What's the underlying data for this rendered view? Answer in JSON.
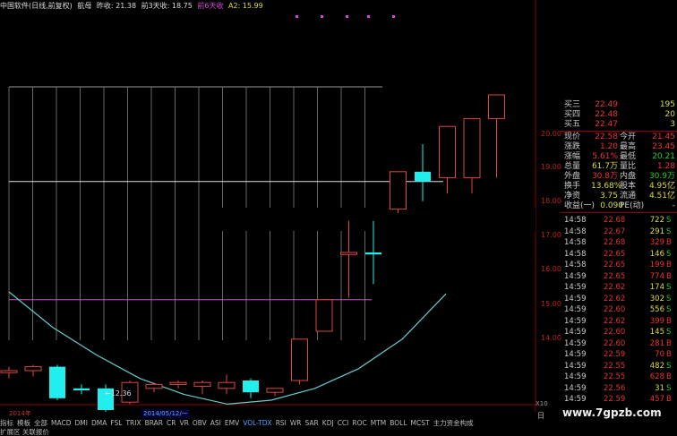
{
  "header": {
    "name": "中国软件(日线,前复权)",
    "extra": "航母",
    "prev_close": "昨收: 21.38",
    "prev3": "前3天收: 18.75",
    "prev6": "前6天收",
    "a2": "A2: 15.99"
  },
  "y_axis": [
    "20.00",
    "19.00",
    "18.00",
    "17.00",
    "16.00",
    "15.00",
    "14.00"
  ],
  "chart_data": {
    "type": "candlestick",
    "ylim": [
      13.25,
      20.75
    ],
    "candles": [
      {
        "o": 13.95,
        "h": 14.1,
        "l": 13.8,
        "c": 14.0
      },
      {
        "o": 14.0,
        "h": 14.15,
        "l": 13.85,
        "c": 14.1
      },
      {
        "o": 14.1,
        "h": 14.15,
        "l": 13.25,
        "c": 13.3
      },
      {
        "o": 13.55,
        "h": 13.65,
        "l": 13.4,
        "c": 13.5
      },
      {
        "o": 13.55,
        "h": 13.65,
        "l": 12.9,
        "c": 13.0
      },
      {
        "o": 13.2,
        "h": 13.75,
        "l": 13.15,
        "c": 13.7
      },
      {
        "o": 13.55,
        "h": 13.7,
        "l": 13.45,
        "c": 13.65
      },
      {
        "o": 13.65,
        "h": 13.75,
        "l": 13.55,
        "c": 13.7
      },
      {
        "o": 13.6,
        "h": 13.75,
        "l": 13.4,
        "c": 13.7
      },
      {
        "o": 13.55,
        "h": 13.9,
        "l": 13.4,
        "c": 13.7
      },
      {
        "o": 13.75,
        "h": 13.8,
        "l": 13.3,
        "c": 13.45
      },
      {
        "o": 13.45,
        "h": 13.55,
        "l": 13.35,
        "c": 13.55
      },
      {
        "o": 13.75,
        "h": 14.8,
        "l": 13.65,
        "c": 14.8
      },
      {
        "o": 15.0,
        "h": 15.8,
        "l": 15.0,
        "c": 15.8
      },
      {
        "o": 16.95,
        "h": 17.8,
        "l": 15.85,
        "c": 17.0
      },
      {
        "o": 17.0,
        "h": 17.8,
        "l": 16.2,
        "c": 16.95
      },
      {
        "o": 18.1,
        "h": 18.75,
        "l": 18.0,
        "c": 19.05
      },
      {
        "o": 19.05,
        "h": 19.75,
        "l": 18.3,
        "c": 18.8
      },
      {
        "o": 18.9,
        "h": 20.2,
        "l": 18.5,
        "c": 20.2
      },
      {
        "o": 18.9,
        "h": 20.4,
        "l": 18.5,
        "c": 20.4
      },
      {
        "o": 20.4,
        "h": 21.0,
        "l": 18.9,
        "c": 21.0
      }
    ],
    "curve": [
      [
        0,
        16.0
      ],
      [
        4,
        15.1
      ],
      [
        8,
        14.4
      ],
      [
        12,
        13.8
      ],
      [
        16,
        13.4
      ],
      [
        20,
        13.15
      ],
      [
        24,
        13.25
      ],
      [
        28,
        13.55
      ],
      [
        32,
        14.05
      ],
      [
        36,
        14.8
      ],
      [
        40,
        15.95
      ]
    ],
    "hlines": [
      18.8,
      15.8
    ],
    "low_note": "←12.36"
  },
  "panel": {
    "orders": [
      {
        "label": "买三",
        "price": "22.49",
        "vol": "195"
      },
      {
        "label": "买四",
        "price": "22.48",
        "vol": "20"
      },
      {
        "label": "买五",
        "price": "22.47",
        "vol": "3"
      }
    ],
    "stats": [
      {
        "l1": "现价",
        "v1": "22.58",
        "l2": "今开",
        "v2": "21.45"
      },
      {
        "l1": "涨跌",
        "v1": "1.20",
        "l2": "最高",
        "v2": "23.45"
      },
      {
        "l1": "涨幅",
        "v1": "5.61%",
        "l2": "最低",
        "v2": "20.21"
      },
      {
        "l1": "总量",
        "v1": "61.7万",
        "l2": "量比",
        "v2": "1.28"
      },
      {
        "l1": "外盘",
        "v1": "30.8万",
        "l2": "内盘",
        "v2": "30.9万"
      },
      {
        "l1": "换手",
        "v1": "13.68%",
        "l2": "股本",
        "v2": "4.95亿"
      },
      {
        "l1": "净资",
        "v1": "3.75",
        "l2": "流通",
        "v2": "4.51亿"
      },
      {
        "l1": "收益(一)",
        "v1": "0.090",
        "l2": "PE(动)",
        "v2": "-"
      }
    ],
    "ticks": [
      {
        "t": "14:58",
        "p": "22.68",
        "q": "722",
        "s": "S"
      },
      {
        "t": "14:58",
        "p": "22.67",
        "q": "291",
        "s": "S"
      },
      {
        "t": "14:58",
        "p": "22.68",
        "q": "329",
        "s": "B"
      },
      {
        "t": "14:58",
        "p": "22.65",
        "q": "146",
        "s": "S"
      },
      {
        "t": "14:58",
        "p": "22.65",
        "q": "199",
        "s": "B"
      },
      {
        "t": "14:59",
        "p": "22.65",
        "q": "774",
        "s": "B"
      },
      {
        "t": "14:59",
        "p": "22.62",
        "q": "174",
        "s": "S"
      },
      {
        "t": "14:59",
        "p": "22.62",
        "q": "302",
        "s": "S"
      },
      {
        "t": "14:59",
        "p": "22.60",
        "q": "556",
        "s": "S"
      },
      {
        "t": "14:59",
        "p": "22.62",
        "q": "399",
        "s": "B"
      },
      {
        "t": "14:59",
        "p": "22.60",
        "q": "145",
        "s": "S"
      },
      {
        "t": "14:59",
        "p": "22.60",
        "q": "281",
        "s": "B"
      },
      {
        "t": "14:59",
        "p": "22.59",
        "q": "70",
        "s": "B"
      },
      {
        "t": "14:59",
        "p": "22.55",
        "q": "482",
        "s": "S"
      },
      {
        "t": "14:59",
        "p": "22.55",
        "q": "628",
        "s": "B"
      },
      {
        "t": "14:59",
        "p": "22.56",
        "q": "31",
        "s": "S"
      },
      {
        "t": "14:59",
        "p": "22.59",
        "q": "457",
        "s": "B"
      }
    ]
  },
  "bottom": {
    "year": "2014年",
    "date": "2014/05/12/一",
    "x10": "X10",
    "day": "日"
  },
  "tabs": [
    "指标",
    "模板",
    "全部",
    "MACD",
    "DMI",
    "DMA",
    "FSL",
    "TRIX",
    "BRAR",
    "CR",
    "VR",
    "OBV",
    "ASI",
    "EMV",
    "VOL-TDX",
    "RSI",
    "WR",
    "SAR",
    "KDJ",
    "CCI",
    "ROC",
    "MTM",
    "BOLL",
    "MCST",
    "主力资金构成"
  ],
  "active_tab": 14,
  "tabs2": [
    "扩展区",
    "关联报价"
  ],
  "logo": "www.7gpzb.com"
}
